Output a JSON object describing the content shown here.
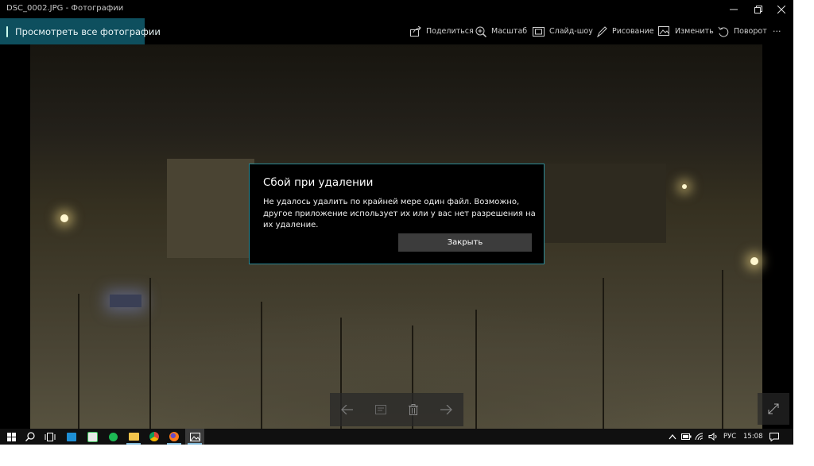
{
  "window": {
    "title": "DSC_0002.JPG - Фотографии"
  },
  "toolbar": {
    "view_all": "Просмотреть все фотографии",
    "share": "Поделиться",
    "zoom": "Масштаб",
    "slideshow": "Слайд-шоу",
    "draw": "Рисование",
    "edit": "Изменить",
    "rotate": "Поворот",
    "more": "···"
  },
  "dialog": {
    "title": "Сбой при удалении",
    "message": "Не удалось удалить по крайней мере один файл. Возможно, другое приложение использует их или у вас нет разрешения на их удаление.",
    "close_label": "Закрыть"
  },
  "taskbar": {
    "language": "РУС",
    "time": "15:08",
    "apps": [
      "start",
      "search",
      "task-view",
      "store",
      "whatsapp",
      "spotify",
      "file-explorer",
      "chrome",
      "firefox",
      "photos"
    ]
  },
  "colors": {
    "accent": "#0e4f5e",
    "dialog_border": "#2b8a96"
  }
}
